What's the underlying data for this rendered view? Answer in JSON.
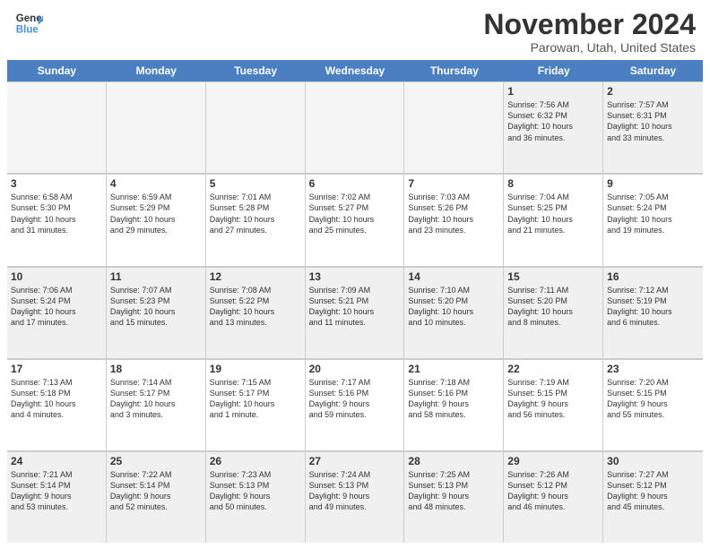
{
  "header": {
    "logo_line1": "General",
    "logo_line2": "Blue",
    "month_title": "November 2024",
    "location": "Parowan, Utah, United States"
  },
  "days_of_week": [
    "Sunday",
    "Monday",
    "Tuesday",
    "Wednesday",
    "Thursday",
    "Friday",
    "Saturday"
  ],
  "weeks": [
    [
      {
        "day": "",
        "info": "",
        "empty": true
      },
      {
        "day": "",
        "info": "",
        "empty": true
      },
      {
        "day": "",
        "info": "",
        "empty": true
      },
      {
        "day": "",
        "info": "",
        "empty": true
      },
      {
        "day": "",
        "info": "",
        "empty": true
      },
      {
        "day": "1",
        "info": "Sunrise: 7:56 AM\nSunset: 6:32 PM\nDaylight: 10 hours\nand 36 minutes.",
        "empty": false,
        "shaded": true
      },
      {
        "day": "2",
        "info": "Sunrise: 7:57 AM\nSunset: 6:31 PM\nDaylight: 10 hours\nand 33 minutes.",
        "empty": false,
        "shaded": true
      }
    ],
    [
      {
        "day": "3",
        "info": "Sunrise: 6:58 AM\nSunset: 5:30 PM\nDaylight: 10 hours\nand 31 minutes.",
        "empty": false,
        "shaded": false
      },
      {
        "day": "4",
        "info": "Sunrise: 6:59 AM\nSunset: 5:29 PM\nDaylight: 10 hours\nand 29 minutes.",
        "empty": false,
        "shaded": false
      },
      {
        "day": "5",
        "info": "Sunrise: 7:01 AM\nSunset: 5:28 PM\nDaylight: 10 hours\nand 27 minutes.",
        "empty": false,
        "shaded": false
      },
      {
        "day": "6",
        "info": "Sunrise: 7:02 AM\nSunset: 5:27 PM\nDaylight: 10 hours\nand 25 minutes.",
        "empty": false,
        "shaded": false
      },
      {
        "day": "7",
        "info": "Sunrise: 7:03 AM\nSunset: 5:26 PM\nDaylight: 10 hours\nand 23 minutes.",
        "empty": false,
        "shaded": false
      },
      {
        "day": "8",
        "info": "Sunrise: 7:04 AM\nSunset: 5:25 PM\nDaylight: 10 hours\nand 21 minutes.",
        "empty": false,
        "shaded": false
      },
      {
        "day": "9",
        "info": "Sunrise: 7:05 AM\nSunset: 5:24 PM\nDaylight: 10 hours\nand 19 minutes.",
        "empty": false,
        "shaded": false
      }
    ],
    [
      {
        "day": "10",
        "info": "Sunrise: 7:06 AM\nSunset: 5:24 PM\nDaylight: 10 hours\nand 17 minutes.",
        "empty": false,
        "shaded": true
      },
      {
        "day": "11",
        "info": "Sunrise: 7:07 AM\nSunset: 5:23 PM\nDaylight: 10 hours\nand 15 minutes.",
        "empty": false,
        "shaded": true
      },
      {
        "day": "12",
        "info": "Sunrise: 7:08 AM\nSunset: 5:22 PM\nDaylight: 10 hours\nand 13 minutes.",
        "empty": false,
        "shaded": true
      },
      {
        "day": "13",
        "info": "Sunrise: 7:09 AM\nSunset: 5:21 PM\nDaylight: 10 hours\nand 11 minutes.",
        "empty": false,
        "shaded": true
      },
      {
        "day": "14",
        "info": "Sunrise: 7:10 AM\nSunset: 5:20 PM\nDaylight: 10 hours\nand 10 minutes.",
        "empty": false,
        "shaded": true
      },
      {
        "day": "15",
        "info": "Sunrise: 7:11 AM\nSunset: 5:20 PM\nDaylight: 10 hours\nand 8 minutes.",
        "empty": false,
        "shaded": true
      },
      {
        "day": "16",
        "info": "Sunrise: 7:12 AM\nSunset: 5:19 PM\nDaylight: 10 hours\nand 6 minutes.",
        "empty": false,
        "shaded": true
      }
    ],
    [
      {
        "day": "17",
        "info": "Sunrise: 7:13 AM\nSunset: 5:18 PM\nDaylight: 10 hours\nand 4 minutes.",
        "empty": false,
        "shaded": false
      },
      {
        "day": "18",
        "info": "Sunrise: 7:14 AM\nSunset: 5:17 PM\nDaylight: 10 hours\nand 3 minutes.",
        "empty": false,
        "shaded": false
      },
      {
        "day": "19",
        "info": "Sunrise: 7:15 AM\nSunset: 5:17 PM\nDaylight: 10 hours\nand 1 minute.",
        "empty": false,
        "shaded": false
      },
      {
        "day": "20",
        "info": "Sunrise: 7:17 AM\nSunset: 5:16 PM\nDaylight: 9 hours\nand 59 minutes.",
        "empty": false,
        "shaded": false
      },
      {
        "day": "21",
        "info": "Sunrise: 7:18 AM\nSunset: 5:16 PM\nDaylight: 9 hours\nand 58 minutes.",
        "empty": false,
        "shaded": false
      },
      {
        "day": "22",
        "info": "Sunrise: 7:19 AM\nSunset: 5:15 PM\nDaylight: 9 hours\nand 56 minutes.",
        "empty": false,
        "shaded": false
      },
      {
        "day": "23",
        "info": "Sunrise: 7:20 AM\nSunset: 5:15 PM\nDaylight: 9 hours\nand 55 minutes.",
        "empty": false,
        "shaded": false
      }
    ],
    [
      {
        "day": "24",
        "info": "Sunrise: 7:21 AM\nSunset: 5:14 PM\nDaylight: 9 hours\nand 53 minutes.",
        "empty": false,
        "shaded": true
      },
      {
        "day": "25",
        "info": "Sunrise: 7:22 AM\nSunset: 5:14 PM\nDaylight: 9 hours\nand 52 minutes.",
        "empty": false,
        "shaded": true
      },
      {
        "day": "26",
        "info": "Sunrise: 7:23 AM\nSunset: 5:13 PM\nDaylight: 9 hours\nand 50 minutes.",
        "empty": false,
        "shaded": true
      },
      {
        "day": "27",
        "info": "Sunrise: 7:24 AM\nSunset: 5:13 PM\nDaylight: 9 hours\nand 49 minutes.",
        "empty": false,
        "shaded": true
      },
      {
        "day": "28",
        "info": "Sunrise: 7:25 AM\nSunset: 5:13 PM\nDaylight: 9 hours\nand 48 minutes.",
        "empty": false,
        "shaded": true
      },
      {
        "day": "29",
        "info": "Sunrise: 7:26 AM\nSunset: 5:12 PM\nDaylight: 9 hours\nand 46 minutes.",
        "empty": false,
        "shaded": true
      },
      {
        "day": "30",
        "info": "Sunrise: 7:27 AM\nSunset: 5:12 PM\nDaylight: 9 hours\nand 45 minutes.",
        "empty": false,
        "shaded": true
      }
    ]
  ]
}
